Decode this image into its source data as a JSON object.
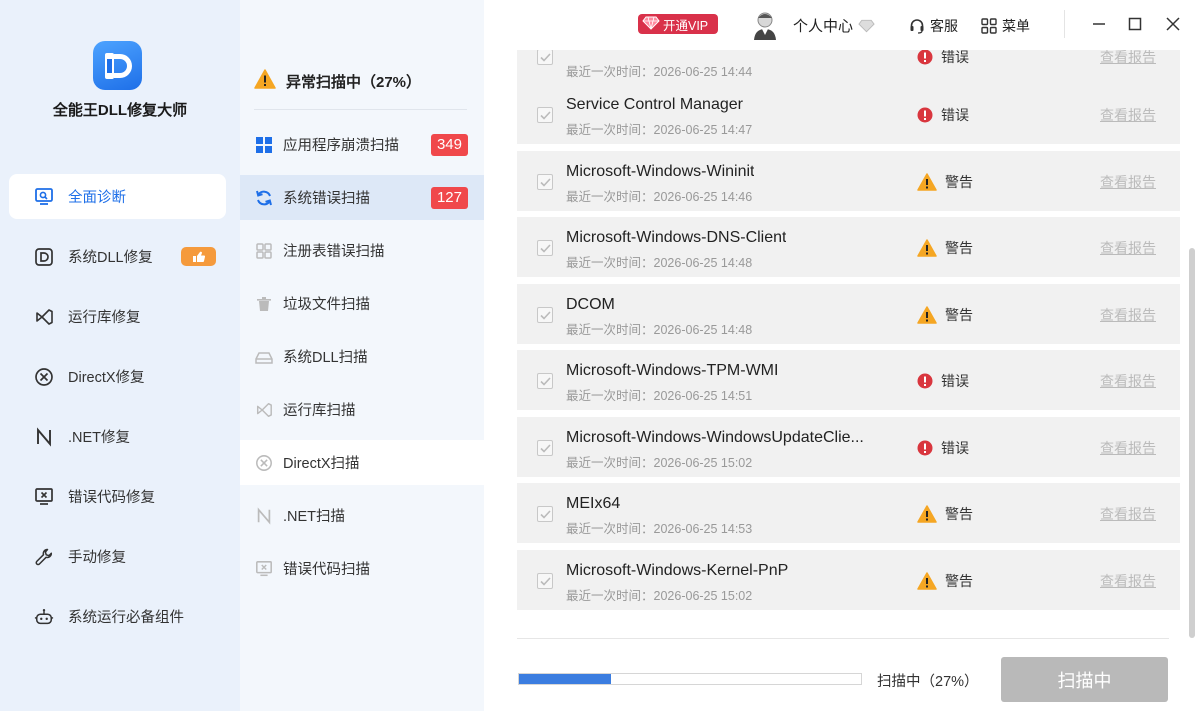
{
  "app": {
    "title": "全能王DLL修复大师"
  },
  "topbar": {
    "vip_label": "开通VIP",
    "user_center": "个人中心",
    "service": "客服",
    "menu": "菜单"
  },
  "sidebar": {
    "items": [
      {
        "label": "全面诊断",
        "icon": "monitor-search-icon"
      },
      {
        "label": "系统DLL修复",
        "icon": "dll-d-icon"
      },
      {
        "label": "运行库修复",
        "icon": "vs-runtime-icon"
      },
      {
        "label": "DirectX修复",
        "icon": "directx-icon"
      },
      {
        "label": ".NET修复",
        "icon": "dotnet-n-icon"
      },
      {
        "label": "错误代码修复",
        "icon": "error-code-monitor-icon"
      },
      {
        "label": "手动修复",
        "icon": "wrench-icon"
      },
      {
        "label": "系统运行必备组件",
        "icon": "robot-icon"
      }
    ]
  },
  "scan": {
    "header": "异常扫描中（27%）",
    "items": [
      {
        "label": "应用程序崩溃扫描",
        "count": "349"
      },
      {
        "label": "系统错误扫描",
        "count": "127"
      },
      {
        "label": "注册表错误扫描"
      },
      {
        "label": "垃圾文件扫描"
      },
      {
        "label": "系统DLL扫描"
      },
      {
        "label": "运行库扫描"
      },
      {
        "label": "DirectX扫描"
      },
      {
        "label": ".NET扫描"
      },
      {
        "label": "错误代码扫描"
      }
    ]
  },
  "results": {
    "report_label": "查看报告",
    "time_prefix": "最近一次时间：",
    "status_colors": {
      "error": "#d9363e",
      "warning": "#f5a623"
    },
    "rows": [
      {
        "name": "",
        "time": "2026-06-25 14:44",
        "status": "错误",
        "level": "error"
      },
      {
        "name": "Service Control Manager",
        "time": "2026-06-25 14:47",
        "status": "错误",
        "level": "error"
      },
      {
        "name": "Microsoft-Windows-Wininit",
        "time": "2026-06-25 14:46",
        "status": "警告",
        "level": "warning"
      },
      {
        "name": "Microsoft-Windows-DNS-Client",
        "time": "2026-06-25 14:48",
        "status": "警告",
        "level": "warning"
      },
      {
        "name": "DCOM",
        "time": "2026-06-25 14:48",
        "status": "警告",
        "level": "warning"
      },
      {
        "name": "Microsoft-Windows-TPM-WMI",
        "time": "2026-06-25 14:51",
        "status": "错误",
        "level": "error"
      },
      {
        "name": "Microsoft-Windows-WindowsUpdateClie...",
        "time": "2026-06-25 15:02",
        "status": "错误",
        "level": "error"
      },
      {
        "name": "MEIx64",
        "time": "2026-06-25 14:53",
        "status": "警告",
        "level": "warning"
      },
      {
        "name": "Microsoft-Windows-Kernel-PnP",
        "time": "2026-06-25 15:02",
        "status": "警告",
        "level": "warning"
      }
    ]
  },
  "footer": {
    "progress_percent": 27,
    "progress_text": "扫描中（27%）",
    "scan_button": "扫描中"
  }
}
